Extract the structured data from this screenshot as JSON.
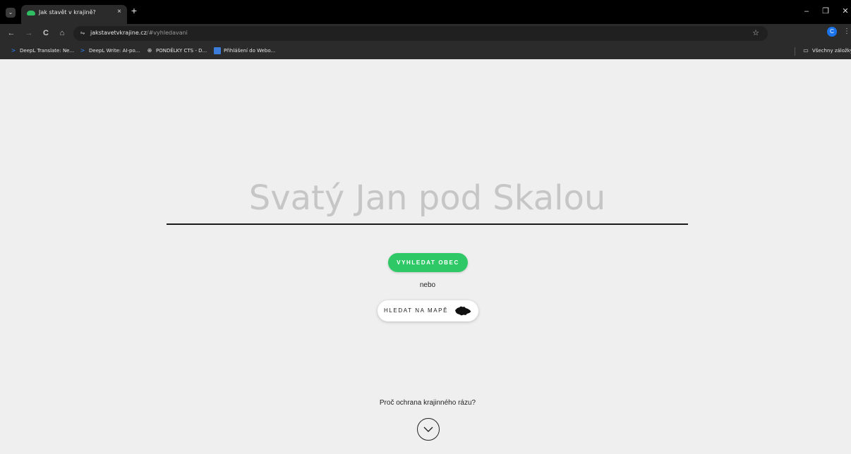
{
  "browser": {
    "tab": {
      "title": "Jak stavět v krajině?",
      "close": "×",
      "new_tab": "+"
    },
    "window": {
      "minimize": "–",
      "restore": "❐",
      "close": "✕"
    },
    "nav": {
      "back": "←",
      "forward": "→",
      "reload": "C",
      "home": "⌂"
    },
    "address": {
      "host": "jakstavetvkrajine.cz",
      "rest": "/#vyhledavani",
      "star": "☆",
      "site_info": "⇋"
    },
    "profile_initial": "C",
    "menu": "⋮",
    "bookmarks": [
      {
        "label": "DeepL Translate: Ne...",
        "icon": "deepl-icon"
      },
      {
        "label": "DeepL Write: AI-po...",
        "icon": "deepl-icon"
      },
      {
        "label": "PONDĚLKY CTS - D...",
        "icon": "globe-icon"
      },
      {
        "label": "Přihlášení do Webo...",
        "icon": "webo-icon"
      }
    ],
    "all_bookmarks": "Všechny záložky"
  },
  "page": {
    "search": {
      "placeholder": "Svatý Jan pod Skalou"
    },
    "search_button": "VYHLEDAT OBEC",
    "or_text": "nebo",
    "map_button": "HLEDAT NA MAPĚ",
    "why_link": "Proč ochrana krajinného rázu?"
  },
  "colors": {
    "accent": "#2ec866",
    "background": "#efefef"
  }
}
